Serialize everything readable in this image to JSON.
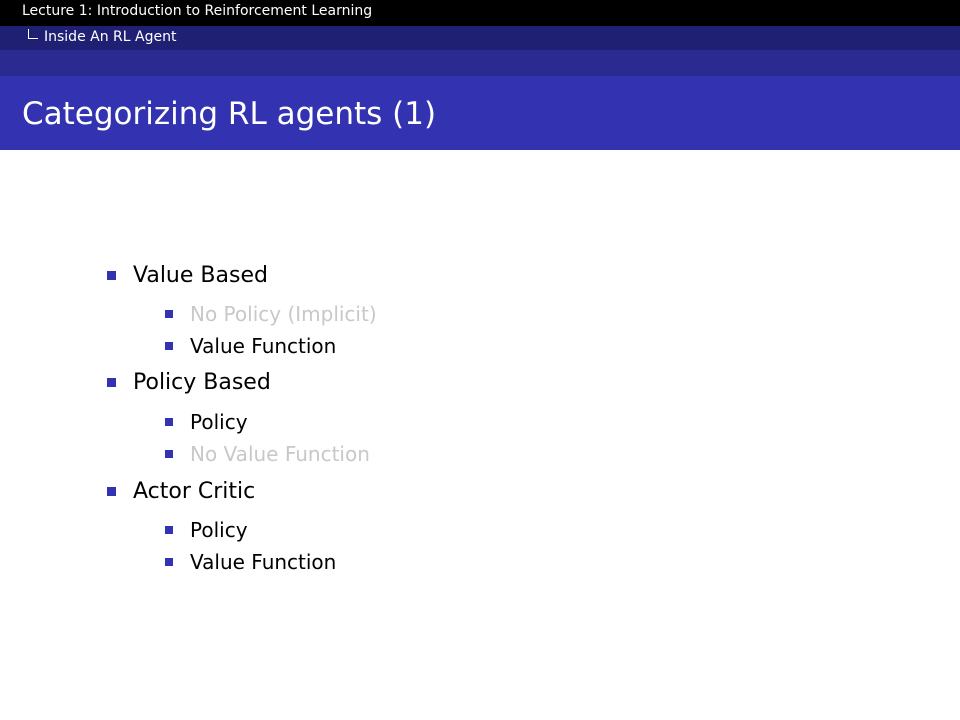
{
  "header": {
    "lecture_title": "Lecture 1: Introduction to Reinforcement Learning",
    "section": "Inside An RL Agent"
  },
  "frame": {
    "title": "Categorizing RL agents (1)"
  },
  "outline": [
    {
      "label": "Value Based",
      "children": [
        {
          "label": "No Policy (Implicit)",
          "greyed": true
        },
        {
          "label": "Value Function",
          "greyed": false
        }
      ]
    },
    {
      "label": "Policy Based",
      "children": [
        {
          "label": "Policy",
          "greyed": false
        },
        {
          "label": "No Value Function",
          "greyed": true
        }
      ]
    },
    {
      "label": "Actor Critic",
      "children": [
        {
          "label": "Policy",
          "greyed": false
        },
        {
          "label": "Value Function",
          "greyed": false
        }
      ]
    }
  ],
  "colors": {
    "header_bg": "#000000",
    "subheader_bg": "#1f1f73",
    "frame_title_bg": "#3333b2",
    "bullet": "#3333b2",
    "greyed_text": "#c8c8c8"
  }
}
